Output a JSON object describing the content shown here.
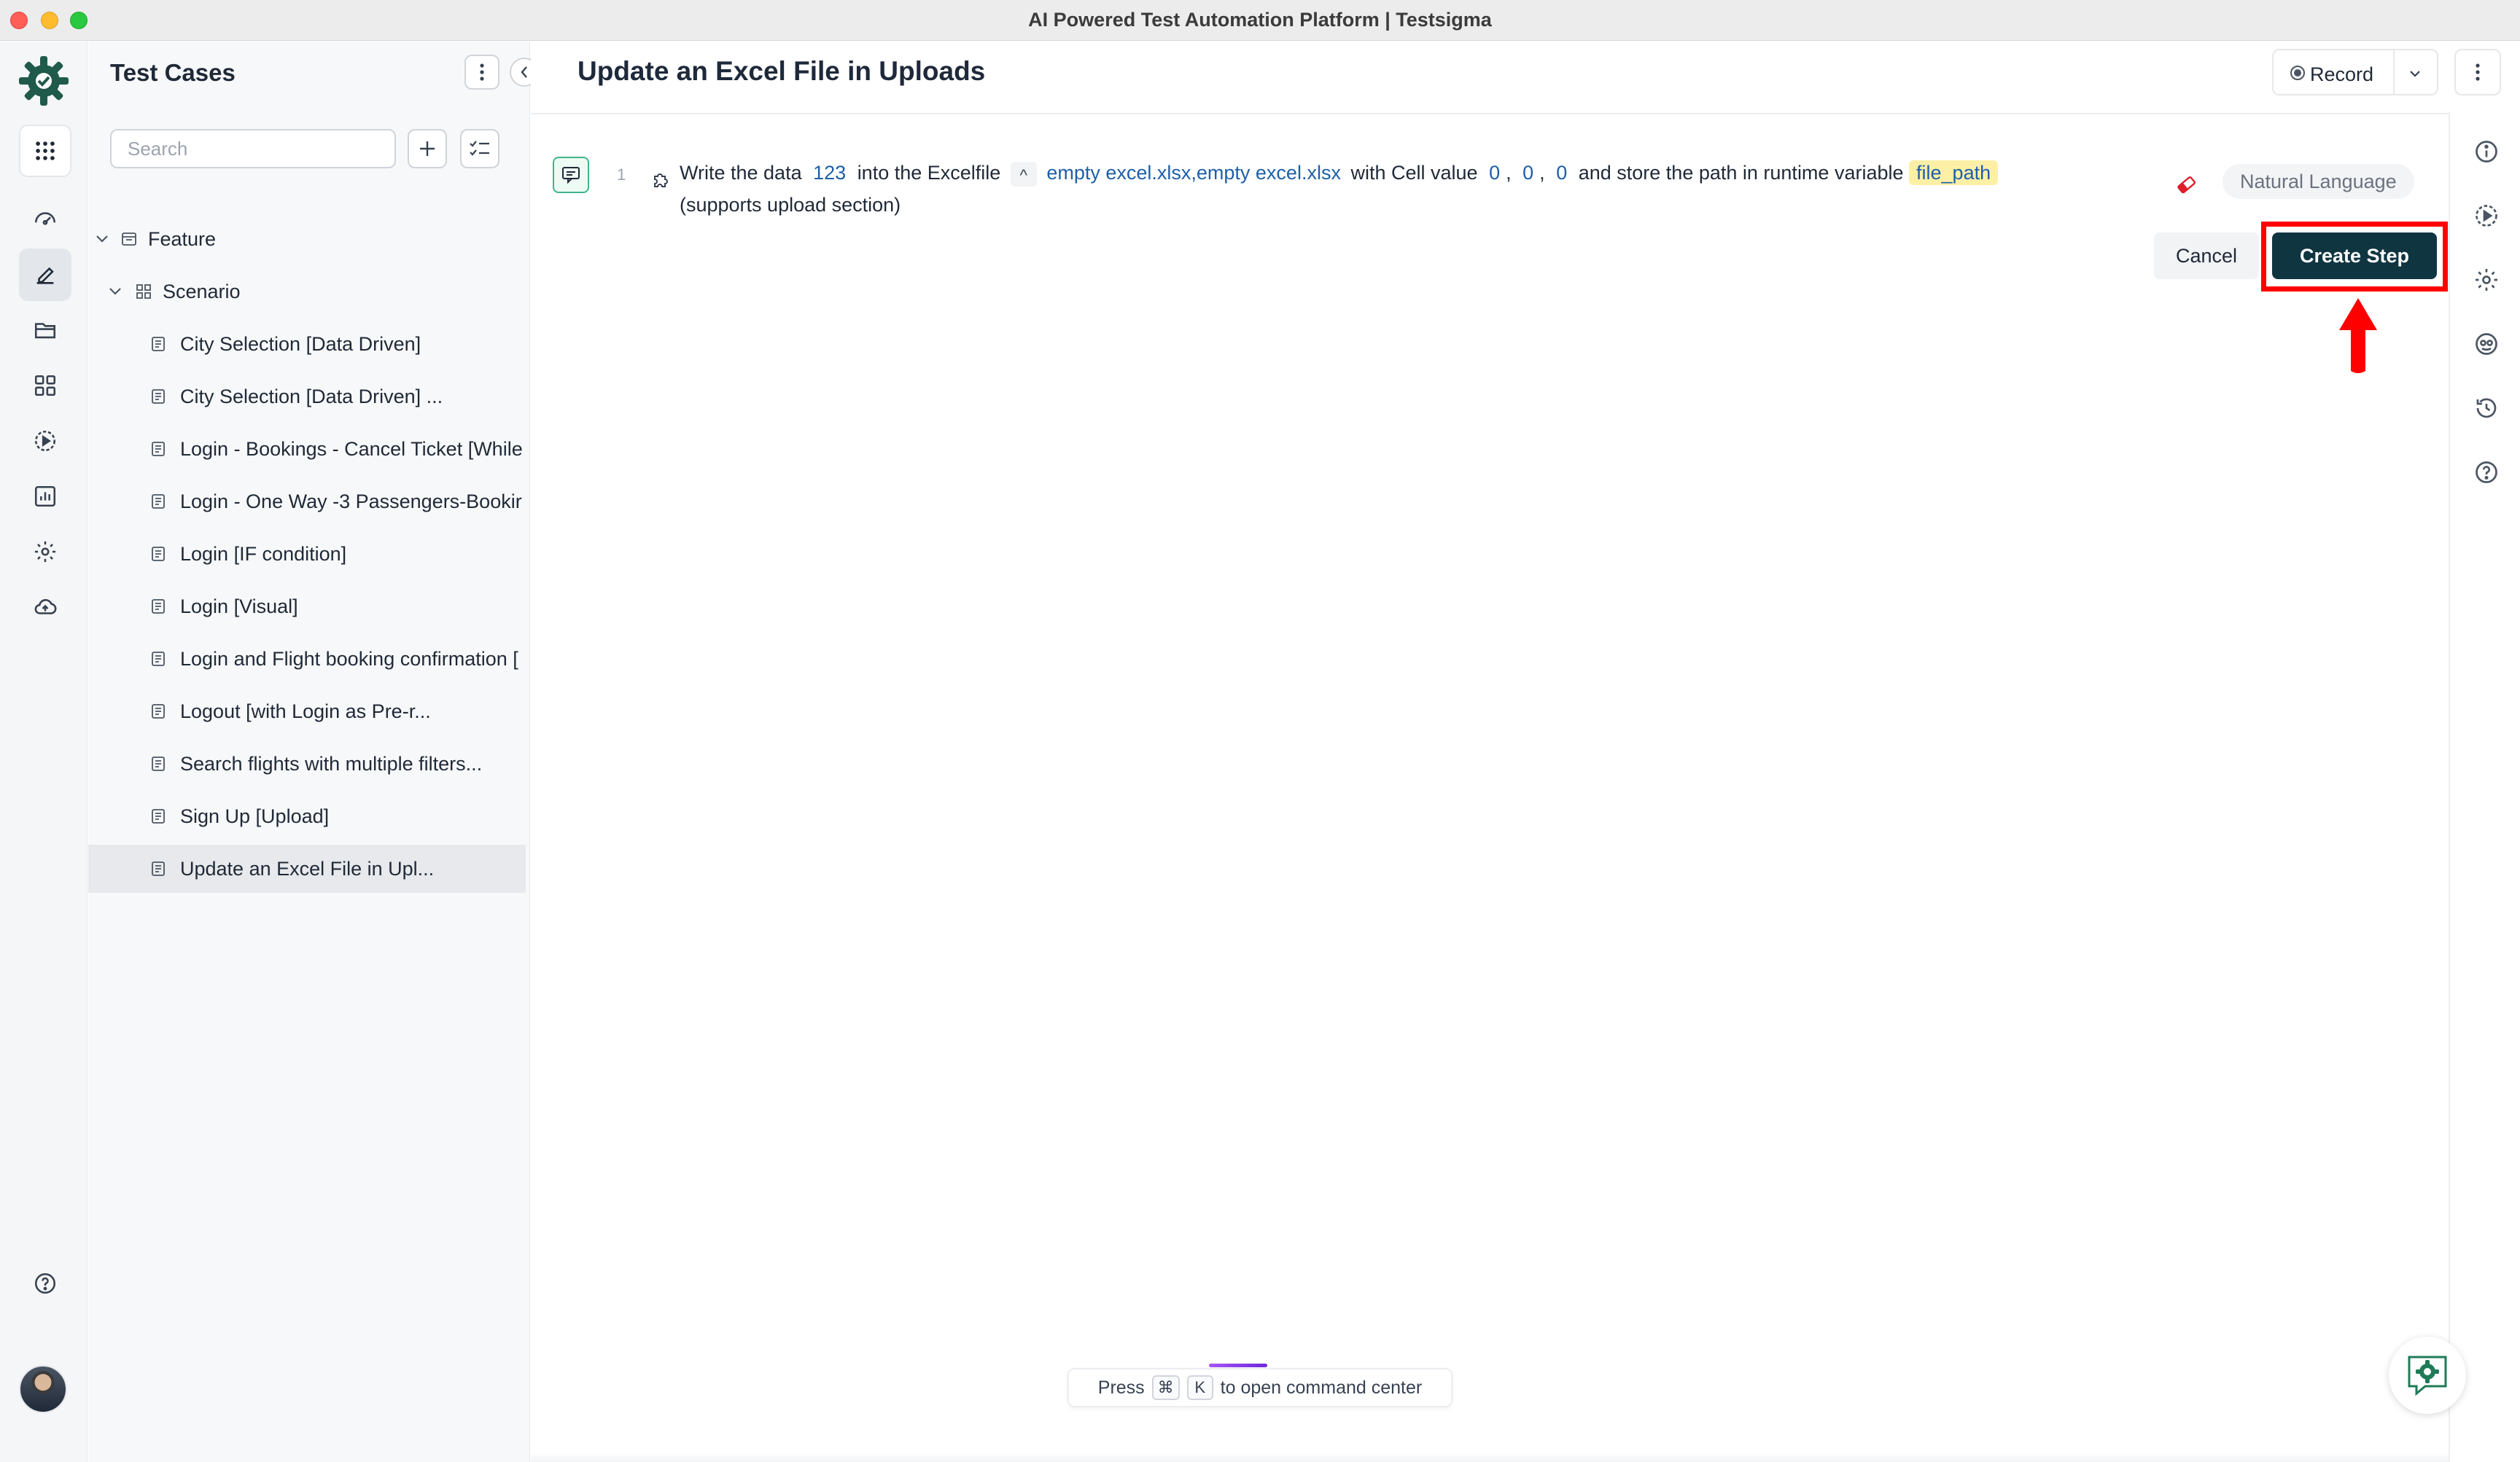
{
  "window": {
    "title": "AI Powered Test Automation Platform | Testsigma"
  },
  "rail": {
    "items": [
      {
        "name": "apps-icon"
      },
      {
        "name": "dashboard-icon"
      },
      {
        "name": "test-cases-icon"
      },
      {
        "name": "test-data-icon"
      },
      {
        "name": "elements-icon"
      },
      {
        "name": "run-icon"
      },
      {
        "name": "reports-icon"
      },
      {
        "name": "settings-icon"
      },
      {
        "name": "upload-cloud-icon"
      },
      {
        "name": "help-icon"
      }
    ],
    "active": "test-cases-icon"
  },
  "explorer": {
    "title": "Test Cases",
    "search_placeholder": "Search",
    "feature_label": "Feature",
    "scenario_label": "Scenario",
    "test_cases": [
      "City Selection [Data Driven]",
      "City Selection [Data Driven] ...",
      "Login - Bookings - Cancel Ticket [While",
      "Login - One Way -3 Passengers-Bookir",
      "Login [IF condition]",
      "Login [Visual]",
      "Login and Flight booking confirmation [",
      "Logout [with Login as Pre-r...",
      "Search flights with multiple filters...",
      "Sign Up [Upload]",
      "Update an Excel File in Upl..."
    ],
    "selected_index": 10
  },
  "main": {
    "title": "Update an Excel File in Uploads",
    "record_label": "Record",
    "step": {
      "number": "1",
      "text_write": "Write the data",
      "data_value": "123",
      "text_into": "into the Excelfile",
      "caret": "^",
      "file_value": "empty excel.xlsx,empty excel.xlsx",
      "text_cell": "with Cell value",
      "cell_a": "0",
      "cell_b": "0",
      "cell_c": "0",
      "comma": ",",
      "text_store": "and store the path in runtime variable",
      "variable": "file_path",
      "text_supports": "(supports upload section)",
      "mode_badge": "Natural Language"
    },
    "cancel_label": "Cancel",
    "create_label": "Create Step",
    "command_hint": {
      "press": "Press",
      "key1": "⌘",
      "key2": "K",
      "suffix": "to open command center"
    }
  },
  "colors": {
    "primary": "#0f3541",
    "highlight_red": "#ff0000",
    "variable_bg": "#fdf0a6",
    "token_blue": "#1d5fa8",
    "brand_green": "#1f7a57"
  }
}
